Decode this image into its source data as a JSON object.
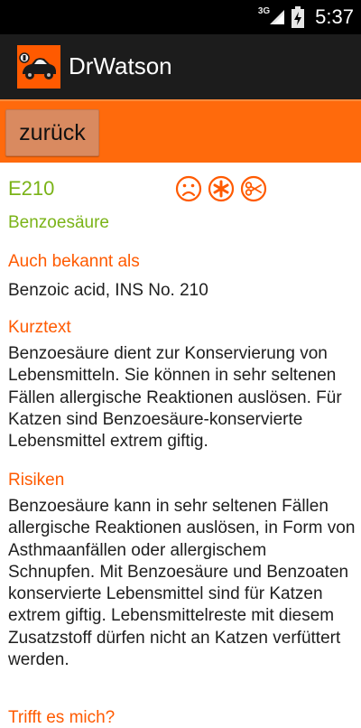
{
  "status_bar": {
    "network": "3G",
    "time": "5:37"
  },
  "app": {
    "title": "DrWatson",
    "logo_icon": "car-logo-icon",
    "accent_color": "#ff6a0c"
  },
  "toolbar": {
    "back_label": "zurück"
  },
  "additive": {
    "code": "E210",
    "name": "Benzoesäure",
    "warning_icons": [
      "sad-face-icon",
      "allergy-asterisk-icon",
      "scissors-icon"
    ]
  },
  "sections": {
    "also_known": {
      "title": "Auch bekannt als",
      "text": "Benzoic acid, INS No. 210"
    },
    "short_text": {
      "title": "Kurztext",
      "text": "Benzoesäure dient zur Konservierung von Lebensmitteln. Sie können in sehr seltenen Fällen allergische Reaktionen auslösen. Für Katzen sind Benzoesäure-konservierte Lebensmittel extrem giftig."
    },
    "risks": {
      "title": "Risiken",
      "text": "Benzoesäure kann in sehr seltenen Fällen allergische Reaktionen auslösen, in Form von Asthmaanfällen oder allergischem Schnupfen. Mit Benzoesäure und Benzoaten konservierte Lebensmittel sind für Katzen extrem giftig. Lebensmittelreste mit diesem Zusatzstoff dürfen nicht an Katzen verfüttert werden."
    },
    "affects_me": {
      "title": "Trifft es mich?"
    }
  }
}
